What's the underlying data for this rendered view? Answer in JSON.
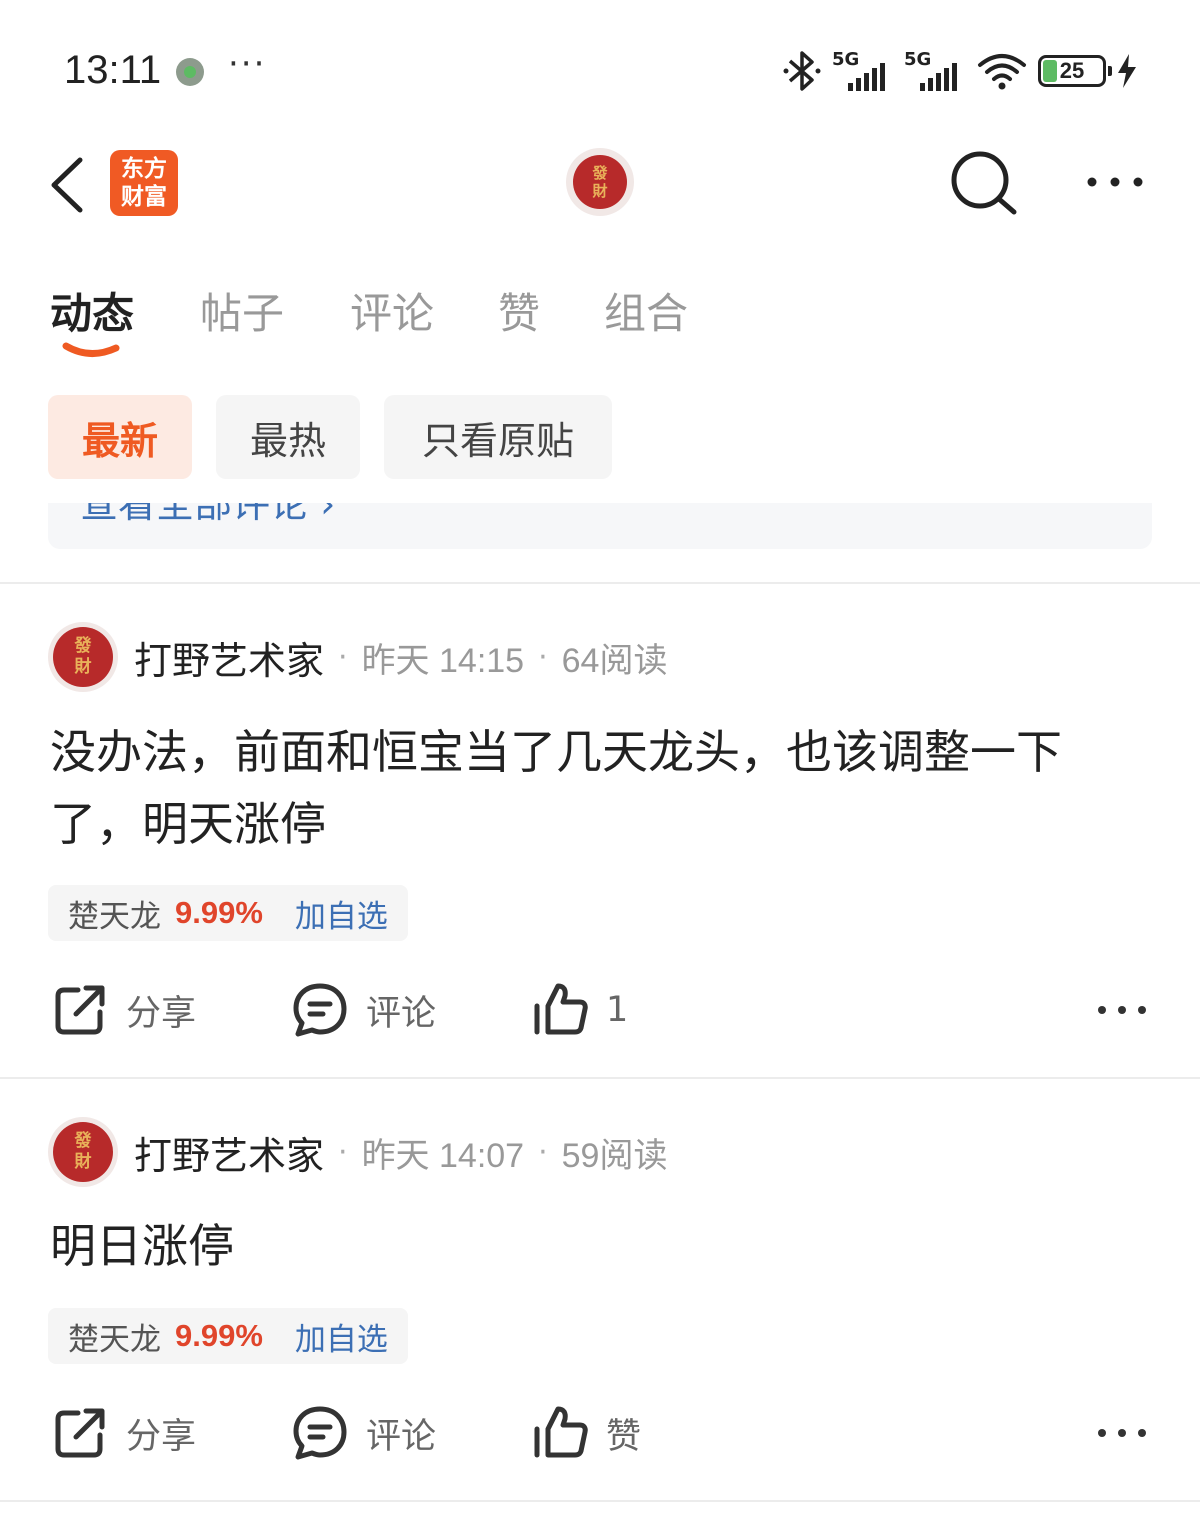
{
  "status_bar": {
    "time": "13:11",
    "more": "···",
    "net1": "5G",
    "net2": "5G",
    "battery": "25",
    "icons": [
      "notification-dot-icon",
      "bluetooth-icon",
      "signal-icon",
      "wifi-icon",
      "battery-icon",
      "charging-icon"
    ]
  },
  "header": {
    "logo_line1": "东方",
    "logo_line2": "财富",
    "avatar_line1": "發",
    "avatar_line2": "財",
    "icons": [
      "back-icon",
      "search-icon",
      "more-icon"
    ]
  },
  "tabs": [
    {
      "label": "动态",
      "active": true
    },
    {
      "label": "帖子",
      "active": false
    },
    {
      "label": "评论",
      "active": false
    },
    {
      "label": "赞",
      "active": false
    },
    {
      "label": "组合",
      "active": false
    }
  ],
  "filters": [
    {
      "label": "最新",
      "active": true
    },
    {
      "label": "最热",
      "active": false
    },
    {
      "label": "只看原贴",
      "active": false
    }
  ],
  "partial_card": {
    "link_text": "查看全部评论 ›"
  },
  "posts": [
    {
      "avatar_line1": "發",
      "avatar_line2": "財",
      "author": "打野艺术家",
      "sep": "·",
      "time": "昨天 14:15",
      "reads": "64阅读",
      "body": "没办法，前面和恒宝当了几天龙头，也该调整一下了，明天涨停",
      "stock_name": "楚天龙",
      "stock_pct": "9.99%",
      "stock_add": "加自选",
      "share": "分享",
      "comment": "评论",
      "like": "1"
    },
    {
      "avatar_line1": "發",
      "avatar_line2": "財",
      "author": "打野艺术家",
      "sep": "·",
      "time": "昨天 14:07",
      "reads": "59阅读",
      "body": "明日涨停",
      "stock_name": "楚天龙",
      "stock_pct": "9.99%",
      "stock_add": "加自选",
      "share": "分享",
      "comment": "评论",
      "like": "赞"
    }
  ],
  "colors": {
    "accent": "#ef5a22",
    "link": "#3c6fb4",
    "up": "#e0452b",
    "logo": "#f05a24",
    "avatar": "#b72a2a"
  }
}
